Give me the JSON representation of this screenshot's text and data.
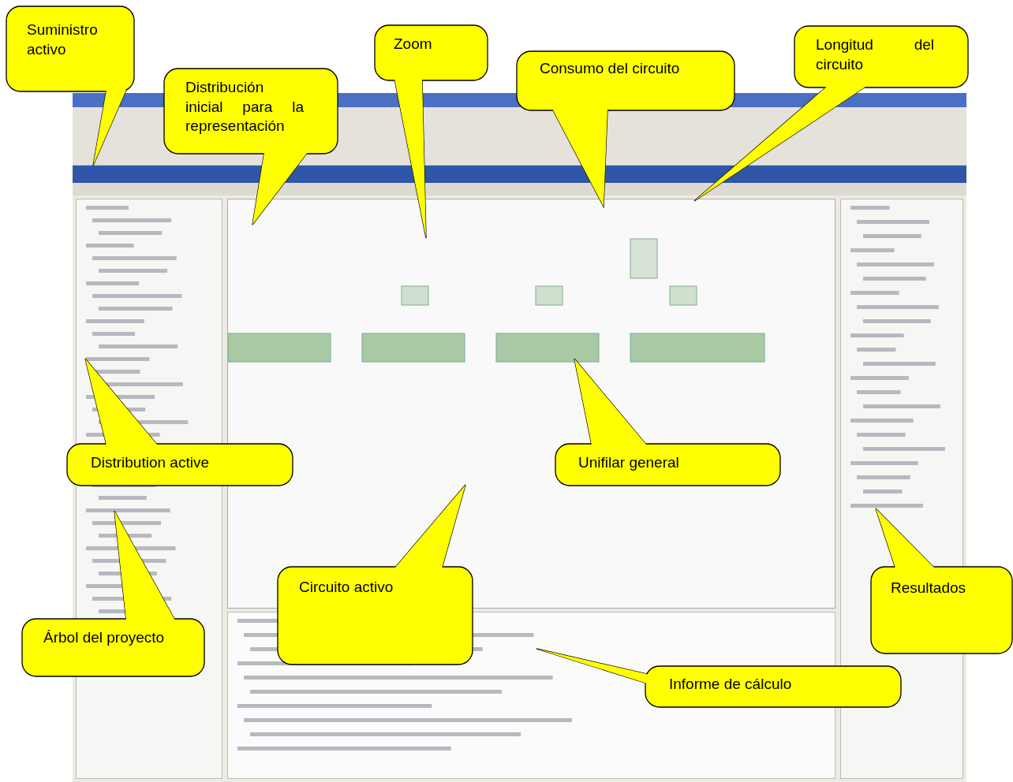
{
  "callouts": [
    {
      "text": "Suministro activo"
    },
    {
      "text": "Distribución inicial para la representación"
    },
    {
      "text": "Zoom"
    },
    {
      "text": "Consumo del circuito"
    },
    {
      "text": "Longitud del circuito"
    },
    {
      "text": "Distribution active"
    },
    {
      "text": "Unifilar general"
    },
    {
      "text": "Circuito activo"
    },
    {
      "text": "Árbol del proyecto"
    },
    {
      "text": "Resultados"
    },
    {
      "text": "Informe de cálculo"
    }
  ]
}
